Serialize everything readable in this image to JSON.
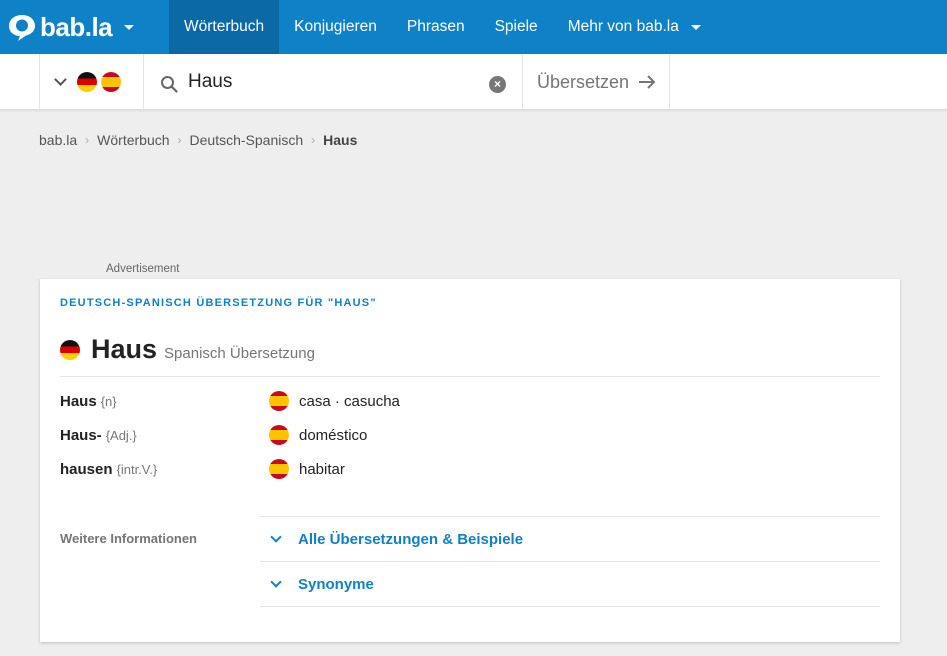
{
  "brand": {
    "name": "bab.la",
    "color": "#0f81c6"
  },
  "nav": {
    "items": [
      {
        "label": "Wörterbuch",
        "active": true
      },
      {
        "label": "Konjugieren",
        "active": false
      },
      {
        "label": "Phrasen",
        "active": false
      },
      {
        "label": "Spiele",
        "active": false
      },
      {
        "label": "Mehr von bab.la",
        "active": false
      }
    ]
  },
  "search": {
    "source_lang_icon": "flag-de-icon",
    "target_lang_icon": "flag-es-icon",
    "value": "Haus",
    "translate_label": "Übersetzen"
  },
  "breadcrumb": [
    "bab.la",
    "Wörterbuch",
    "Deutsch-Spanisch",
    "Haus"
  ],
  "advertisement_label": "Advertisement",
  "card": {
    "heading": "DEUTSCH-SPANISCH ÜBERSETZUNG FÜR \"HAUS\"",
    "word": "Haus",
    "word_subtitle": "Spanisch Übersetzung",
    "entries": [
      {
        "source": "Haus",
        "pos": "{n}",
        "target": "casa · casucha"
      },
      {
        "source": "Haus-",
        "pos": "{Adj.}",
        "target": "doméstico"
      },
      {
        "source": "hausen",
        "pos": "{intr.V.}",
        "target": "habitar"
      }
    ],
    "more_info_label": "Weitere Informationen",
    "more_links": [
      "Alle Übersetzungen & Beispiele",
      "Synonyme"
    ]
  }
}
